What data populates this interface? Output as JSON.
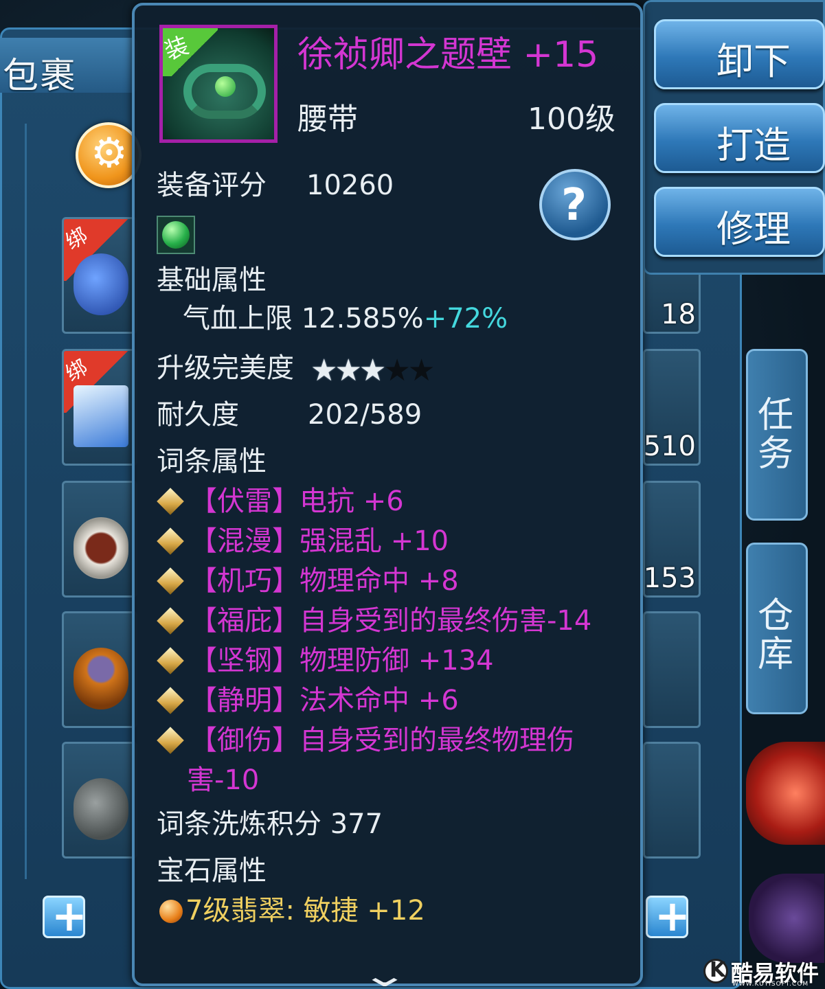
{
  "bag": {
    "title": "包裹",
    "bind_tag": "绑",
    "right_counts": [
      "18",
      "510",
      "153"
    ]
  },
  "actions": {
    "unequip": "卸下",
    "forge": "打造",
    "repair": "修理"
  },
  "side_tabs": {
    "task": "任务",
    "warehouse": "仓库"
  },
  "tooltip": {
    "icon_tag": "装",
    "name": "徐祯卿之题壁 +15",
    "type": "腰带",
    "level": "100级",
    "score_label": "装备评分",
    "score_value": "10260",
    "help_symbol": "?",
    "base_attr_title": "基础属性",
    "base_attr_label": "气血上限",
    "base_attr_value": "12.585%",
    "base_attr_bonus": "+72%",
    "perfection_label": "升级完美度",
    "perfection_stars": 3,
    "perfection_max": 5,
    "durability_label": "耐久度",
    "durability_value": "202/589",
    "affix_title": "词条属性",
    "affixes": [
      {
        "tag": "【伏雷】",
        "text": "电抗 +6"
      },
      {
        "tag": "【混漫】",
        "text": "强混乱 +10"
      },
      {
        "tag": "【机巧】",
        "text": "物理命中 +8"
      },
      {
        "tag": "【福庇】",
        "text": "自身受到的最终伤害-14"
      },
      {
        "tag": "【坚钢】",
        "text": "物理防御 +134"
      },
      {
        "tag": "【静明】",
        "text": "法术命中 +6"
      },
      {
        "tag": "【御伤】",
        "text": "自身受到的最终物理伤",
        "wrap": "害-10"
      }
    ],
    "refine_label": "词条洗炼积分",
    "refine_value": "377",
    "gem_title": "宝石属性",
    "gem_line": "7级翡翠: 敏捷 +12"
  },
  "watermark": {
    "text": "酷易软件园",
    "sub": "WWW.KUYISOFT.COM"
  },
  "colors": {
    "item_name": "#d436d2",
    "bonus": "#44d8de",
    "panel_border": "#4a87b4"
  }
}
